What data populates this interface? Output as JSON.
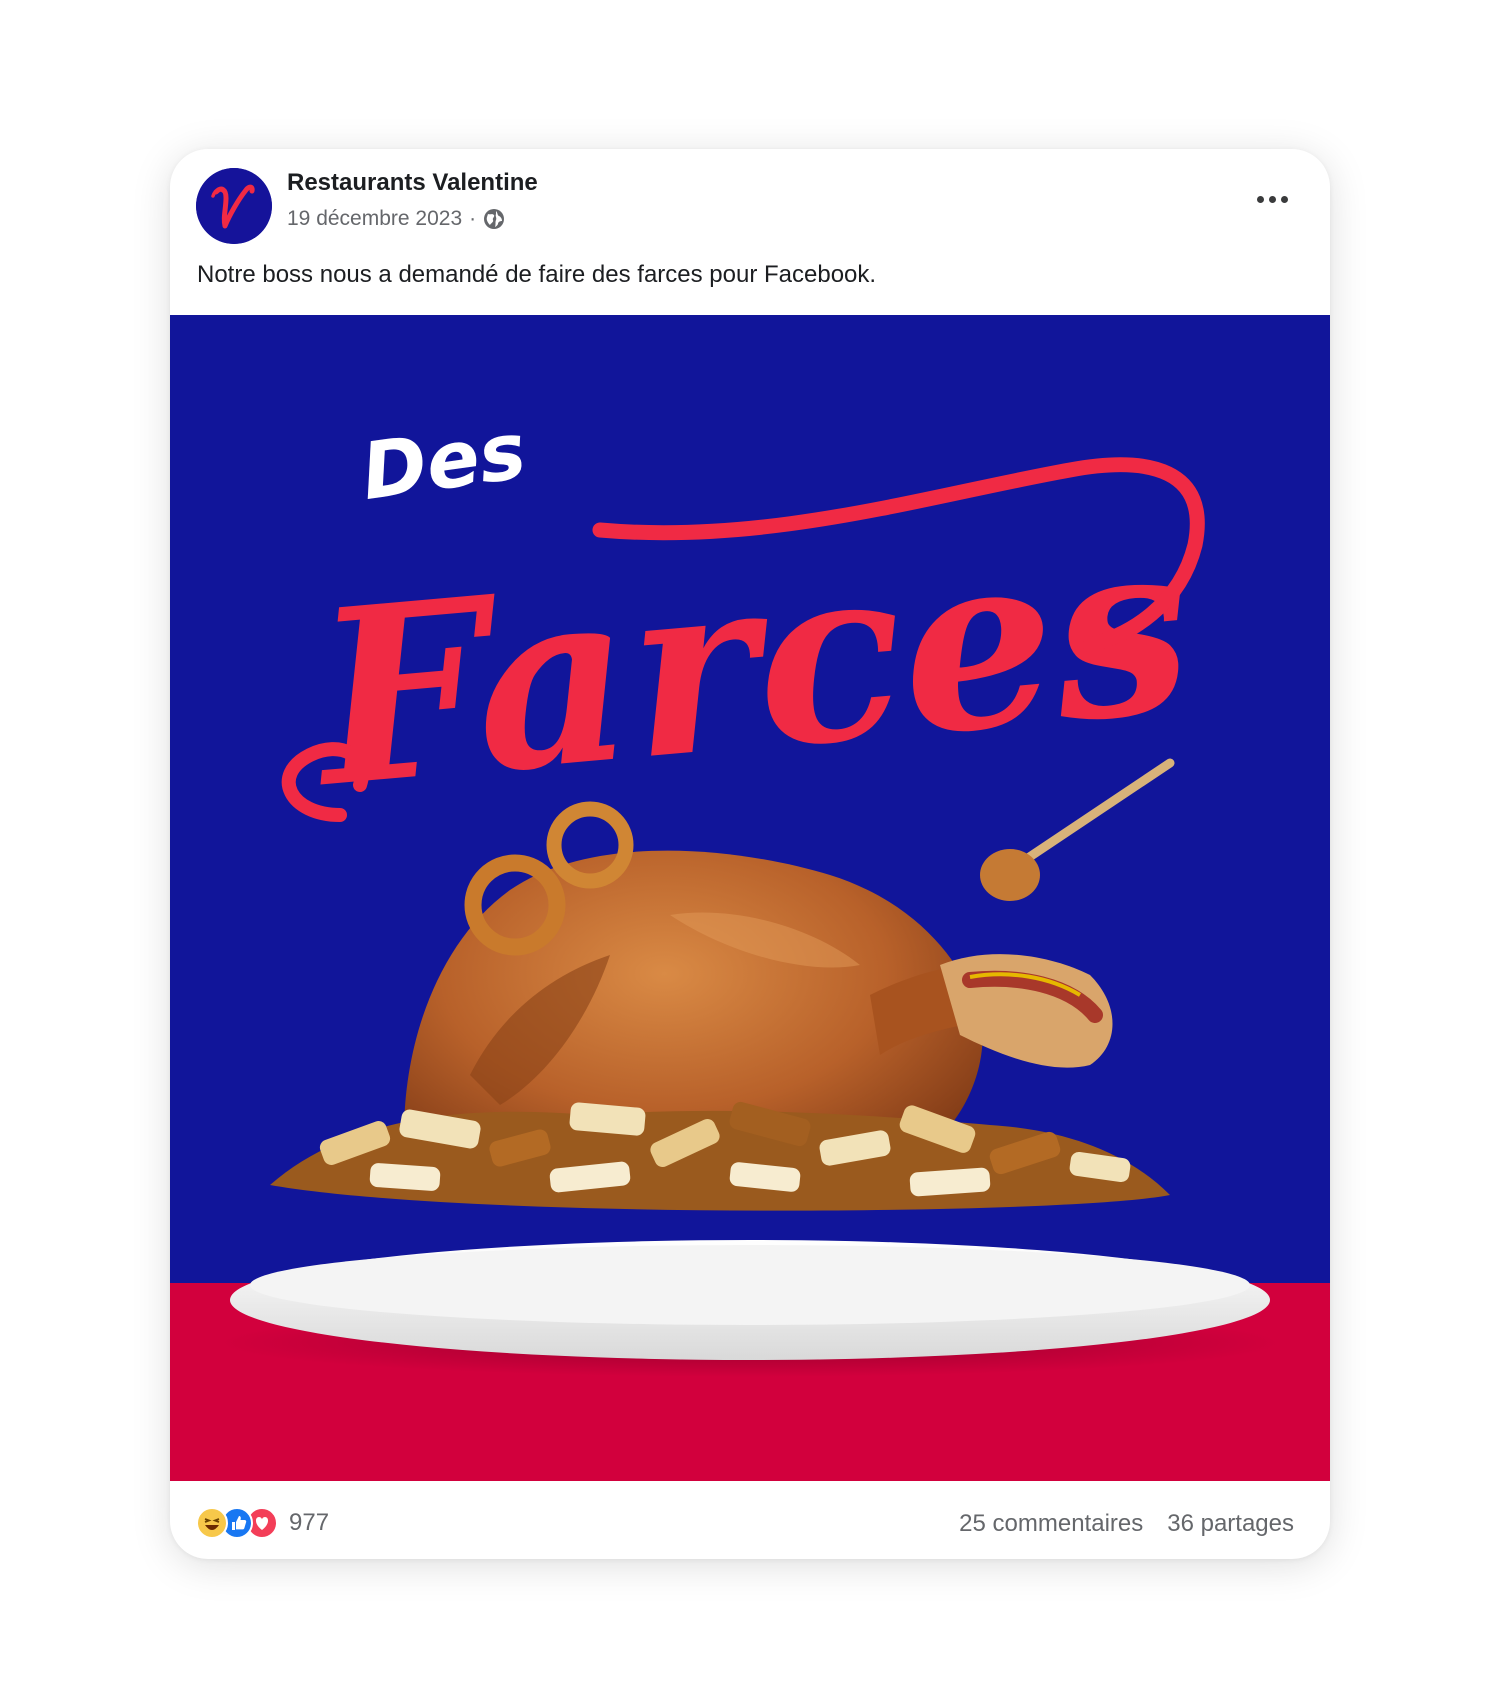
{
  "post": {
    "page_name": "Restaurants Valentine",
    "date": "19 décembre 2023",
    "separator": "·",
    "text": "Notre boss nous a demandé de faire des farces pour Facebook.",
    "avatar_letter": "V"
  },
  "image": {
    "title_top": "Des",
    "title_main": "Farces",
    "colors": {
      "blue_bg": "#11159a",
      "red_floor": "#d2003d",
      "title_red": "#f02a44",
      "title_white": "#ffffff"
    }
  },
  "footer": {
    "reaction_icons": [
      "haha-icon",
      "like-icon",
      "love-icon"
    ],
    "reaction_count": "977",
    "comments": "25 commentaires",
    "shares": "36 partages"
  }
}
